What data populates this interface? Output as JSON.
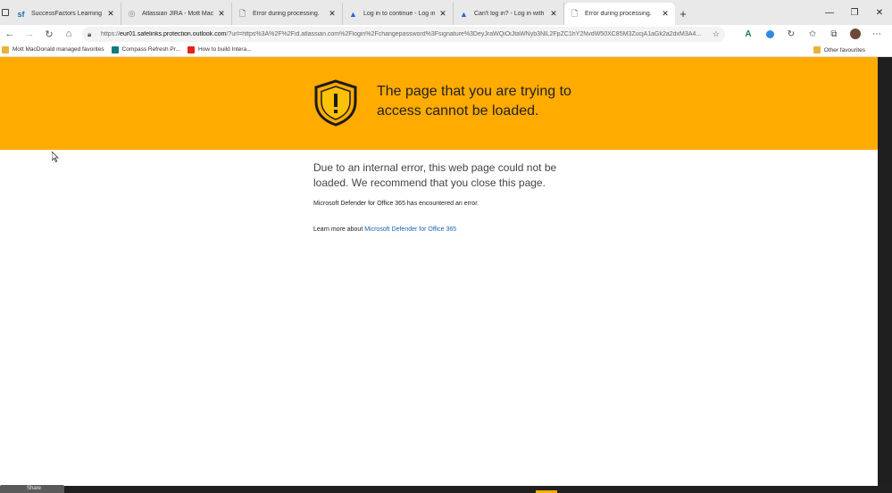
{
  "tabs": [
    {
      "label": "SuccessFactors Learning — Lear",
      "icon": "successfactors-icon",
      "favicon_text": "sf",
      "active": false
    },
    {
      "label": "Atlassian JIRA - Mott MacDonald",
      "icon": "jira-globe-icon",
      "favicon_text": "◎",
      "active": false
    },
    {
      "label": "Error during processing.",
      "icon": "page-icon",
      "favicon_text": "🗋",
      "active": false
    },
    {
      "label": "Log in to continue - Log in with",
      "icon": "atlassian-icon",
      "favicon_text": "▲",
      "active": false
    },
    {
      "label": "Can't log in? - Log in with Atlas",
      "icon": "atlassian-icon",
      "favicon_text": "▲",
      "active": false
    },
    {
      "label": "Error during processing.",
      "icon": "page-icon",
      "favicon_text": "🗋",
      "active": true
    }
  ],
  "address_bar": {
    "url_prefix": "https://",
    "url_host": "eur01.safelinks.protection.outlook.com",
    "url_rest": "/?url=https%3A%2F%2Fid.atlassian.com%2Flogin%2Fchangepassword%3Fsignature%3DeyJraWQiOiJtaWNyb3NlL2FpZC1hY2NvdW50XC85M3ZucjA1aGk2a2dxM3A4..."
  },
  "favorites": [
    {
      "label": "Mott MacDonald managed favorites",
      "icon": "folder-icon",
      "color": "#e8b33a"
    },
    {
      "label": "Compass Refresh Pr...",
      "icon": "sharepoint-icon",
      "color": "#0f7b7b"
    },
    {
      "label": "How to build Intera...",
      "icon": "youtube-icon",
      "color": "#e62117"
    }
  ],
  "other_favourites": "Other favourites",
  "banner": {
    "title": "The page that you are trying to access cannot be loaded.",
    "color": "#ffab00"
  },
  "body": {
    "error_description": "Due to an internal error, this web page could not be loaded. We recommend that you close this page.",
    "defender_message": "Microsoft Defender for Office 365 has encountered an error.",
    "learn_more_prefix": "Learn more about ",
    "learn_more_link": "Microsoft Defender for Office 365"
  },
  "taskbar": {
    "item_label": "Share"
  }
}
